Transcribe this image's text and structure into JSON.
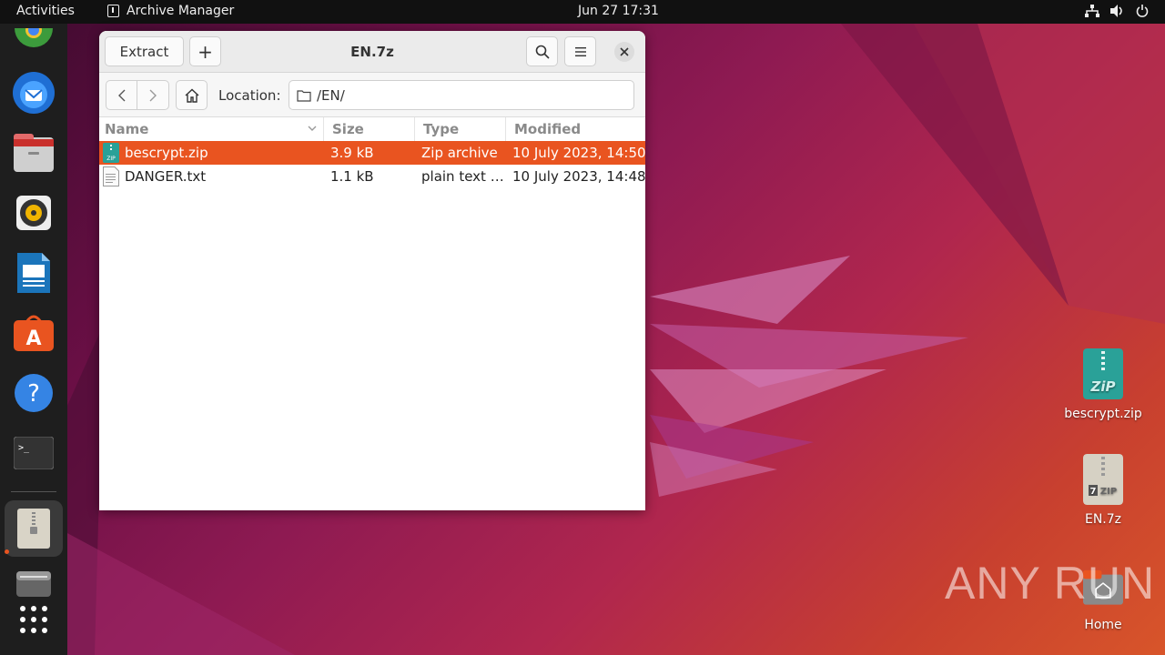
{
  "topbar": {
    "activities": "Activities",
    "app_name": "Archive Manager",
    "clock": "Jun 27  17:31"
  },
  "dock": {
    "items": [
      {
        "icon": "chrome-icon"
      },
      {
        "icon": "thunderbird-icon"
      },
      {
        "icon": "files-icon"
      },
      {
        "icon": "rhythmbox-icon"
      },
      {
        "icon": "writer-icon"
      },
      {
        "icon": "app-center-icon"
      },
      {
        "icon": "help-icon"
      },
      {
        "icon": "terminal-icon"
      },
      {
        "icon": "archive-manager-icon"
      },
      {
        "icon": "disk-icon"
      },
      {
        "icon": "show-apps-icon"
      }
    ]
  },
  "window": {
    "title": "EN.7z",
    "extract_label": "Extract",
    "add_label": "+",
    "location_label": "Location:",
    "location_value": "/EN/",
    "columns": [
      "Name",
      "Size",
      "Type",
      "Modified"
    ],
    "files": [
      {
        "name": "bescrypt.zip",
        "size": "3.9 kB",
        "type": "Zip archive",
        "modified": "10 July 2023, 14:50",
        "selected": true
      },
      {
        "name": "DANGER.txt",
        "size": "1.1 kB",
        "type": "plain text …",
        "modified": "10 July 2023, 14:48",
        "selected": false
      }
    ]
  },
  "desktop": {
    "icons": [
      {
        "label": "bescrypt.zip",
        "icon": "zip-file-icon"
      },
      {
        "label": "EN.7z",
        "icon": "7zip-file-icon"
      },
      {
        "label": "Home",
        "icon": "home-folder-icon"
      }
    ]
  },
  "watermark": "ANY RUN",
  "colors": {
    "accent": "#e95420"
  }
}
